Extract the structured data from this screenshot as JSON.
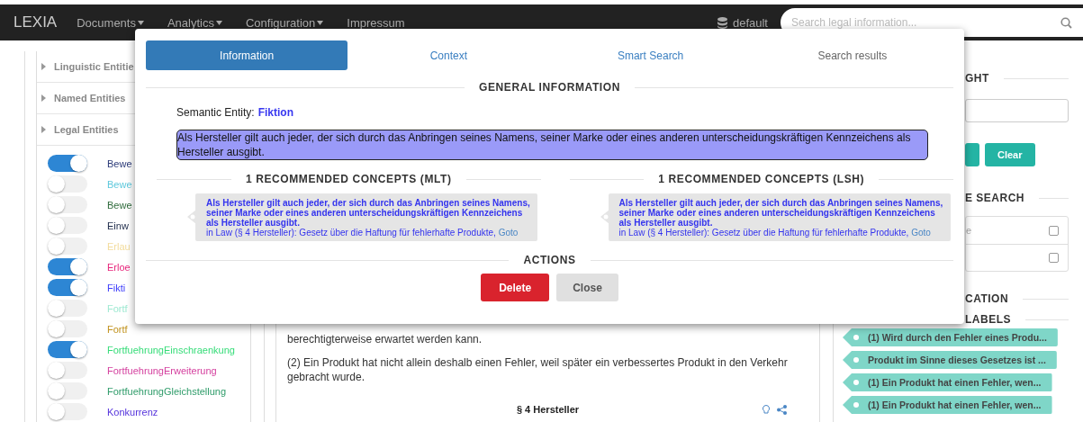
{
  "navbar": {
    "brand": "LEXIA",
    "menus": [
      {
        "label": "Documents",
        "dropdown": true
      },
      {
        "label": "Analytics",
        "dropdown": true
      },
      {
        "label": "Configuration",
        "dropdown": true
      },
      {
        "label": "Impressum",
        "dropdown": false
      }
    ],
    "database": "default",
    "search": {
      "placeholder": "Search legal information..."
    }
  },
  "sidebar": {
    "sections": [
      {
        "label": "Linguistic Entitie"
      },
      {
        "label": "Named Entities"
      },
      {
        "label": "Legal Entities"
      }
    ],
    "toggles": [
      {
        "label": "Bewe",
        "color": "#2b3a78",
        "on": true
      },
      {
        "label": "Bewe",
        "color": "#5cc8dc",
        "on": false
      },
      {
        "label": "Bewe",
        "color": "#2f6b3c",
        "on": false
      },
      {
        "label": "Einw",
        "color": "#1e2b4a",
        "on": false
      },
      {
        "label": "Erlau",
        "color": "#f3dc9c",
        "on": false
      },
      {
        "label": "Erloe",
        "color": "#e8267c",
        "on": true
      },
      {
        "label": "Fikti",
        "color": "#3d3dfa",
        "on": true
      },
      {
        "label": "Fortf",
        "color": "#9fe9d2",
        "on": false
      },
      {
        "label": "Fortf",
        "color": "#c1921e",
        "on": false
      },
      {
        "label": "FortfuehrungEinschraenkung",
        "color": "#35dc78",
        "on": true
      },
      {
        "label": "FortfuehrungErweiterung",
        "color": "#d43f9e",
        "on": false
      },
      {
        "label": "FortfuehrungGleichstellung",
        "color": "#2f9c6a",
        "on": false
      },
      {
        "label": "Konkurrenz",
        "color": "#5533dc",
        "on": false
      }
    ]
  },
  "content": {
    "paragraphs": [
      "berechtigterweise erwartet werden kann.",
      "(2) Ein Produkt hat nicht allein deshalb einen Fehler, weil später ein verbessertes Produkt in den Verkehr gebracht wurde."
    ],
    "heading": "§ 4 Hersteller"
  },
  "right_panel": {
    "headings": [
      "GHT",
      "E SEARCH",
      "CATION",
      "LABELS"
    ],
    "buttons": [
      {
        "label": "Clear"
      }
    ],
    "checkbox_rows": [
      {
        "label": "e",
        "checked": false
      },
      {
        "checked": false
      }
    ],
    "tags": [
      "(1) Wird durch den Fehler eines Produ...",
      "Produkt im Sinne dieses Gesetzes ist ...",
      "(1) Ein Produkt hat einen Fehler, wen...",
      "(1) Ein Produkt hat einen Fehler, wen..."
    ]
  },
  "modal": {
    "tabs": [
      {
        "label": "Information",
        "selected": true,
        "disabled": false
      },
      {
        "label": "Context",
        "selected": false,
        "disabled": false
      },
      {
        "label": "Smart Search",
        "selected": false,
        "disabled": false
      },
      {
        "label": "Search results",
        "selected": false,
        "disabled": true
      }
    ],
    "general_heading": "GENERAL INFORMATION",
    "entity_label": "Semantic Entity:",
    "entity_name": "Fiktion",
    "highlighted_text": "Als Hersteller gilt auch jeder, der sich durch das Anbringen seines Namens, seiner Marke oder eines anderen unterscheidungskräftigen Kennzeichens als Hersteller ausgibt.",
    "concept_columns": [
      {
        "heading": "1 RECOMMENDED CONCEPTS (MLT)",
        "concepts": [
          {
            "text": "Als Hersteller gilt auch jeder, der sich durch das Anbringen seines Namens, seiner Marke oder eines anderen unterscheidungskräftigen Kennzeichens als Hersteller ausgibt.",
            "source": "in Law (§ 4 Hersteller): Gesetz über die Haftung für fehlerhafte Produkte,",
            "link": "Goto"
          }
        ]
      },
      {
        "heading": "1 RECOMMENDED CONCEPTS (LSH)",
        "concepts": [
          {
            "text": "Als Hersteller gilt auch jeder, der sich durch das Anbringen seines Namens, seiner Marke oder eines anderen unterscheidungskräftigen Kennzeichens als Hersteller ausgibt.",
            "source": "in Law (§ 4 Hersteller): Gesetz über die Haftung für fehlerhafte Produkte,",
            "link": "Goto"
          }
        ]
      }
    ],
    "actions_heading": "ACTIONS",
    "buttons": [
      {
        "label": "Delete",
        "kind": "danger"
      },
      {
        "label": "Close",
        "kind": "default"
      }
    ]
  }
}
